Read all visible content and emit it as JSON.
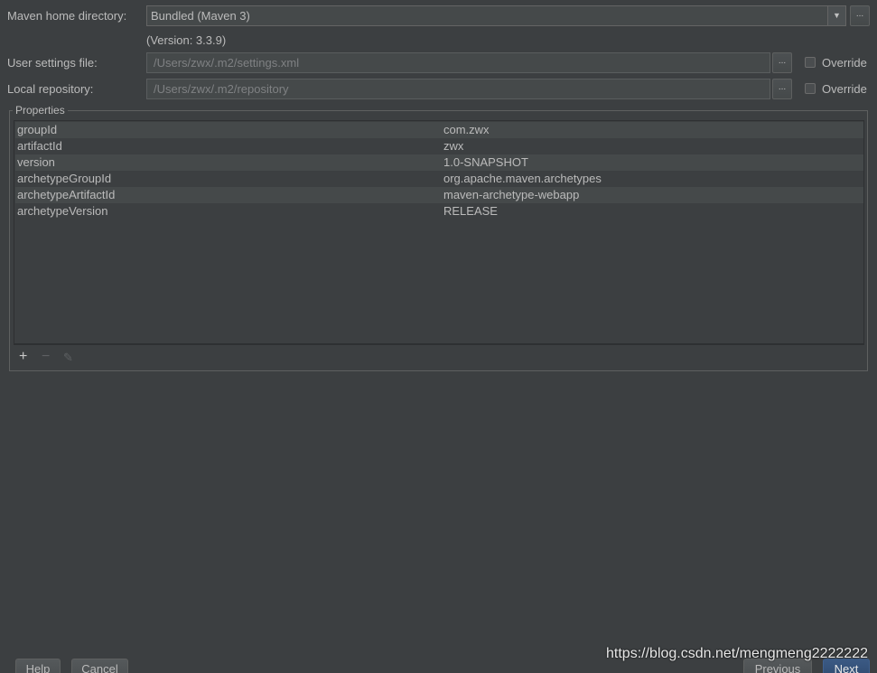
{
  "maven_home": {
    "label": "Maven home directory:",
    "value": "Bundled (Maven 3)",
    "arrow_icon": "▼",
    "browse_label": "...",
    "version": "(Version: 3.3.9)"
  },
  "user_settings": {
    "label": "User settings file:",
    "value": "/Users/zwx/.m2/settings.xml",
    "browse_label": "...",
    "override_label": "Override"
  },
  "local_repo": {
    "label": "Local repository:",
    "value": "/Users/zwx/.m2/repository",
    "browse_label": "...",
    "override_label": "Override"
  },
  "properties": {
    "title": "Properties",
    "rows": [
      {
        "key": "groupId",
        "value": "com.zwx"
      },
      {
        "key": "artifactId",
        "value": "zwx"
      },
      {
        "key": "version",
        "value": "1.0-SNAPSHOT"
      },
      {
        "key": "archetypeGroupId",
        "value": "org.apache.maven.archetypes"
      },
      {
        "key": "archetypeArtifactId",
        "value": "maven-archetype-webapp"
      },
      {
        "key": "archetypeVersion",
        "value": "RELEASE"
      }
    ],
    "toolbar": {
      "add_icon": "+",
      "remove_icon": "−",
      "edit_icon": "✎"
    }
  },
  "footer": {
    "help": "Help",
    "cancel": "Cancel",
    "previous": "Previous",
    "next": "Next"
  },
  "watermark": "https://blog.csdn.net/mengmeng2222222"
}
